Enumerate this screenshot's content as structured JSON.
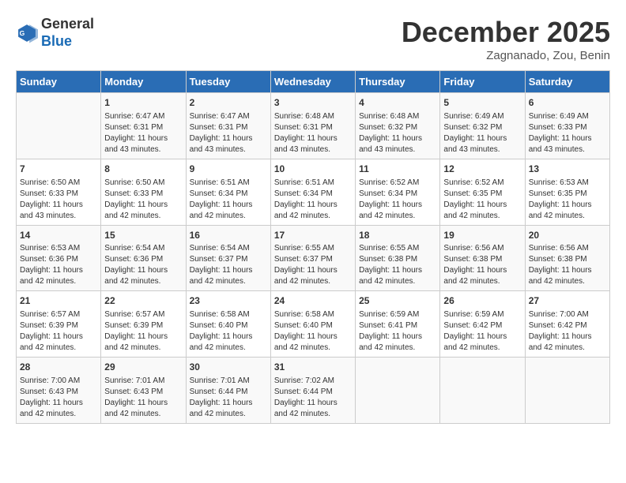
{
  "header": {
    "logo_general": "General",
    "logo_blue": "Blue",
    "month_title": "December 2025",
    "subtitle": "Zagnanado, Zou, Benin"
  },
  "days_of_week": [
    "Sunday",
    "Monday",
    "Tuesday",
    "Wednesday",
    "Thursday",
    "Friday",
    "Saturday"
  ],
  "weeks": [
    [
      {
        "day": "",
        "sunrise": "",
        "sunset": "",
        "daylight": ""
      },
      {
        "day": "1",
        "sunrise": "Sunrise: 6:47 AM",
        "sunset": "Sunset: 6:31 PM",
        "daylight": "Daylight: 11 hours and 43 minutes."
      },
      {
        "day": "2",
        "sunrise": "Sunrise: 6:47 AM",
        "sunset": "Sunset: 6:31 PM",
        "daylight": "Daylight: 11 hours and 43 minutes."
      },
      {
        "day": "3",
        "sunrise": "Sunrise: 6:48 AM",
        "sunset": "Sunset: 6:31 PM",
        "daylight": "Daylight: 11 hours and 43 minutes."
      },
      {
        "day": "4",
        "sunrise": "Sunrise: 6:48 AM",
        "sunset": "Sunset: 6:32 PM",
        "daylight": "Daylight: 11 hours and 43 minutes."
      },
      {
        "day": "5",
        "sunrise": "Sunrise: 6:49 AM",
        "sunset": "Sunset: 6:32 PM",
        "daylight": "Daylight: 11 hours and 43 minutes."
      },
      {
        "day": "6",
        "sunrise": "Sunrise: 6:49 AM",
        "sunset": "Sunset: 6:33 PM",
        "daylight": "Daylight: 11 hours and 43 minutes."
      }
    ],
    [
      {
        "day": "7",
        "sunrise": "Sunrise: 6:50 AM",
        "sunset": "Sunset: 6:33 PM",
        "daylight": "Daylight: 11 hours and 43 minutes."
      },
      {
        "day": "8",
        "sunrise": "Sunrise: 6:50 AM",
        "sunset": "Sunset: 6:33 PM",
        "daylight": "Daylight: 11 hours and 42 minutes."
      },
      {
        "day": "9",
        "sunrise": "Sunrise: 6:51 AM",
        "sunset": "Sunset: 6:34 PM",
        "daylight": "Daylight: 11 hours and 42 minutes."
      },
      {
        "day": "10",
        "sunrise": "Sunrise: 6:51 AM",
        "sunset": "Sunset: 6:34 PM",
        "daylight": "Daylight: 11 hours and 42 minutes."
      },
      {
        "day": "11",
        "sunrise": "Sunrise: 6:52 AM",
        "sunset": "Sunset: 6:34 PM",
        "daylight": "Daylight: 11 hours and 42 minutes."
      },
      {
        "day": "12",
        "sunrise": "Sunrise: 6:52 AM",
        "sunset": "Sunset: 6:35 PM",
        "daylight": "Daylight: 11 hours and 42 minutes."
      },
      {
        "day": "13",
        "sunrise": "Sunrise: 6:53 AM",
        "sunset": "Sunset: 6:35 PM",
        "daylight": "Daylight: 11 hours and 42 minutes."
      }
    ],
    [
      {
        "day": "14",
        "sunrise": "Sunrise: 6:53 AM",
        "sunset": "Sunset: 6:36 PM",
        "daylight": "Daylight: 11 hours and 42 minutes."
      },
      {
        "day": "15",
        "sunrise": "Sunrise: 6:54 AM",
        "sunset": "Sunset: 6:36 PM",
        "daylight": "Daylight: 11 hours and 42 minutes."
      },
      {
        "day": "16",
        "sunrise": "Sunrise: 6:54 AM",
        "sunset": "Sunset: 6:37 PM",
        "daylight": "Daylight: 11 hours and 42 minutes."
      },
      {
        "day": "17",
        "sunrise": "Sunrise: 6:55 AM",
        "sunset": "Sunset: 6:37 PM",
        "daylight": "Daylight: 11 hours and 42 minutes."
      },
      {
        "day": "18",
        "sunrise": "Sunrise: 6:55 AM",
        "sunset": "Sunset: 6:38 PM",
        "daylight": "Daylight: 11 hours and 42 minutes."
      },
      {
        "day": "19",
        "sunrise": "Sunrise: 6:56 AM",
        "sunset": "Sunset: 6:38 PM",
        "daylight": "Daylight: 11 hours and 42 minutes."
      },
      {
        "day": "20",
        "sunrise": "Sunrise: 6:56 AM",
        "sunset": "Sunset: 6:38 PM",
        "daylight": "Daylight: 11 hours and 42 minutes."
      }
    ],
    [
      {
        "day": "21",
        "sunrise": "Sunrise: 6:57 AM",
        "sunset": "Sunset: 6:39 PM",
        "daylight": "Daylight: 11 hours and 42 minutes."
      },
      {
        "day": "22",
        "sunrise": "Sunrise: 6:57 AM",
        "sunset": "Sunset: 6:39 PM",
        "daylight": "Daylight: 11 hours and 42 minutes."
      },
      {
        "day": "23",
        "sunrise": "Sunrise: 6:58 AM",
        "sunset": "Sunset: 6:40 PM",
        "daylight": "Daylight: 11 hours and 42 minutes."
      },
      {
        "day": "24",
        "sunrise": "Sunrise: 6:58 AM",
        "sunset": "Sunset: 6:40 PM",
        "daylight": "Daylight: 11 hours and 42 minutes."
      },
      {
        "day": "25",
        "sunrise": "Sunrise: 6:59 AM",
        "sunset": "Sunset: 6:41 PM",
        "daylight": "Daylight: 11 hours and 42 minutes."
      },
      {
        "day": "26",
        "sunrise": "Sunrise: 6:59 AM",
        "sunset": "Sunset: 6:42 PM",
        "daylight": "Daylight: 11 hours and 42 minutes."
      },
      {
        "day": "27",
        "sunrise": "Sunrise: 7:00 AM",
        "sunset": "Sunset: 6:42 PM",
        "daylight": "Daylight: 11 hours and 42 minutes."
      }
    ],
    [
      {
        "day": "28",
        "sunrise": "Sunrise: 7:00 AM",
        "sunset": "Sunset: 6:43 PM",
        "daylight": "Daylight: 11 hours and 42 minutes."
      },
      {
        "day": "29",
        "sunrise": "Sunrise: 7:01 AM",
        "sunset": "Sunset: 6:43 PM",
        "daylight": "Daylight: 11 hours and 42 minutes."
      },
      {
        "day": "30",
        "sunrise": "Sunrise: 7:01 AM",
        "sunset": "Sunset: 6:44 PM",
        "daylight": "Daylight: 11 hours and 42 minutes."
      },
      {
        "day": "31",
        "sunrise": "Sunrise: 7:02 AM",
        "sunset": "Sunset: 6:44 PM",
        "daylight": "Daylight: 11 hours and 42 minutes."
      },
      {
        "day": "",
        "sunrise": "",
        "sunset": "",
        "daylight": ""
      },
      {
        "day": "",
        "sunrise": "",
        "sunset": "",
        "daylight": ""
      },
      {
        "day": "",
        "sunrise": "",
        "sunset": "",
        "daylight": ""
      }
    ]
  ]
}
